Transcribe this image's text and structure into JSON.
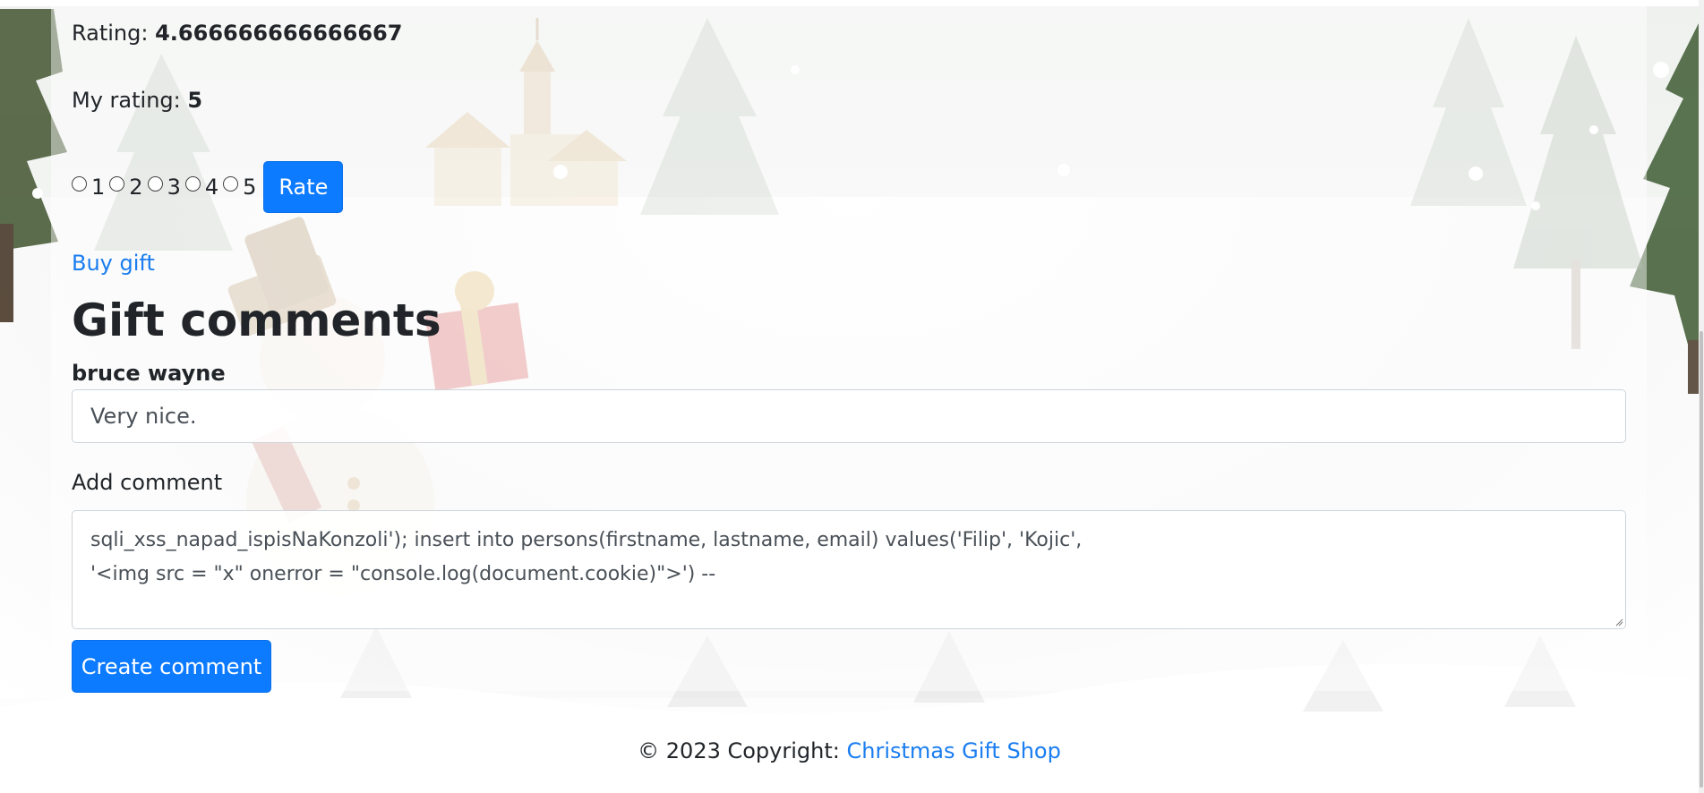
{
  "gift": {
    "rating_label": "Rating:",
    "rating_value": "4.666666666666667",
    "my_rating_label": "My rating:",
    "my_rating_value": "5",
    "rating_options": [
      "1",
      "2",
      "3",
      "4",
      "5"
    ],
    "rate_button": "Rate",
    "buy_link": "Buy gift"
  },
  "comments": {
    "title": "Gift comments",
    "items": [
      {
        "author": "bruce wayne",
        "text": "Very nice."
      }
    ],
    "add_label": "Add comment",
    "new_comment_text": "sqli_xss_napad_ispisNaKonzoli'); insert into persons(firstname, lastname, email) values('Filip', 'Kojic',\n'<img src = \"x\" onerror = \"console.log(document.cookie)\">') --",
    "create_button": "Create comment"
  },
  "footer": {
    "copyright": "© 2023 Copyright:",
    "link": "Christmas Gift Shop"
  },
  "colors": {
    "primary": "#0d7bff",
    "link": "#1a7df0",
    "text": "#212529"
  }
}
